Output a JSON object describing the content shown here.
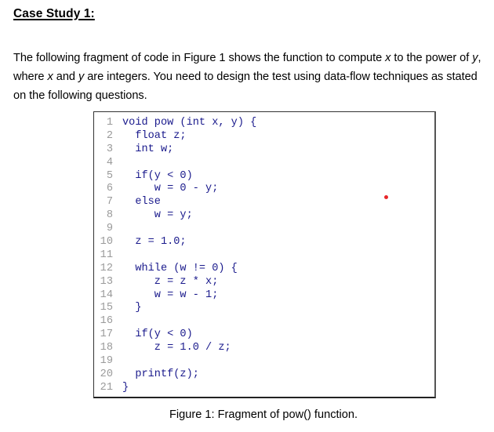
{
  "heading": "Case Study 1:",
  "intro": {
    "line1": [
      {
        "text": "The following fragment of code in Figure 1 shows the function to compute ",
        "italic": false
      },
      {
        "text": "x",
        "italic": true
      },
      {
        "text": " to the power of ",
        "italic": false
      },
      {
        "text": "y",
        "italic": true
      },
      {
        "text": ",",
        "italic": false
      }
    ],
    "line2": [
      {
        "text": "where ",
        "italic": false
      },
      {
        "text": "x",
        "italic": true
      },
      {
        "text": " and ",
        "italic": false
      },
      {
        "text": "y",
        "italic": true
      },
      {
        "text": " are integers. You need to design the test using data-flow techniques as stated",
        "italic": false
      }
    ],
    "line3": [
      {
        "text": "on the following questions.",
        "italic": false
      }
    ]
  },
  "code": {
    "lines": [
      {
        "num": "1",
        "text": "void pow (int x, y) {"
      },
      {
        "num": "2",
        "text": "  float z;"
      },
      {
        "num": "3",
        "text": "  int w;"
      },
      {
        "num": "4",
        "text": ""
      },
      {
        "num": "5",
        "text": "  if(y < 0)"
      },
      {
        "num": "6",
        "text": "     w = 0 - y;"
      },
      {
        "num": "7",
        "text": "  else"
      },
      {
        "num": "8",
        "text": "     w = y;"
      },
      {
        "num": "9",
        "text": ""
      },
      {
        "num": "10",
        "text": "  z = 1.0;"
      },
      {
        "num": "11",
        "text": ""
      },
      {
        "num": "12",
        "text": "  while (w != 0) {"
      },
      {
        "num": "13",
        "text": "     z = z * x;"
      },
      {
        "num": "14",
        "text": "     w = w - 1;"
      },
      {
        "num": "15",
        "text": "  }"
      },
      {
        "num": "16",
        "text": ""
      },
      {
        "num": "17",
        "text": "  if(y < 0)"
      },
      {
        "num": "18",
        "text": "     z = 1.0 / z;"
      },
      {
        "num": "19",
        "text": ""
      },
      {
        "num": "20",
        "text": "  printf(z);"
      },
      {
        "num": "21",
        "text": "}"
      }
    ]
  },
  "caption": "Figure 1: Fragment of pow() function.",
  "colors": {
    "code_text": "#1a1a8c",
    "line_number": "#9a9a9a",
    "marker_dot": "#e8262a"
  }
}
